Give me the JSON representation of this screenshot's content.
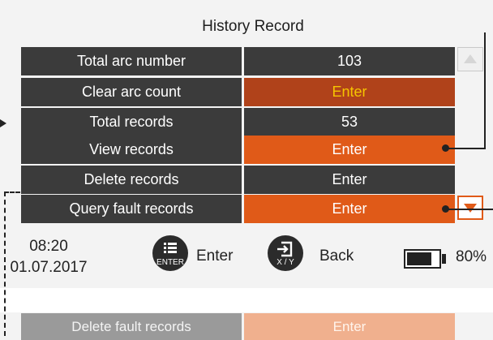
{
  "screen": {
    "title": "History Record",
    "rows": [
      {
        "label": "Total arc number",
        "value": "103"
      },
      {
        "label": "Clear arc count",
        "value": "Enter"
      },
      {
        "label": "Total records",
        "value": "53"
      },
      {
        "label": "View records",
        "value": "Enter"
      },
      {
        "label": "Delete records",
        "value": "Enter"
      },
      {
        "label": "Query fault records",
        "value": "Enter"
      }
    ],
    "next_row": {
      "label": "Delete fault records",
      "value": "Enter"
    }
  },
  "status": {
    "time": "08:20",
    "date": "01.07.2017",
    "enter_key_sub": "ENTER",
    "enter_label": "Enter",
    "back_key_sub": "X / Y",
    "back_label": "Back",
    "battery_percent_text": "80%",
    "battery_level": 0.8
  },
  "colors": {
    "row_bg": "#3b3b3b",
    "highlight": "#e05a18",
    "selected_dark": "#b0421a",
    "selected_text": "#f5c400"
  },
  "icons": {
    "scroll_up": "triangle-up-icon",
    "scroll_down": "triangle-down-icon",
    "enter_key": "list-icon",
    "back_key": "exit-icon",
    "battery": "battery-icon"
  }
}
